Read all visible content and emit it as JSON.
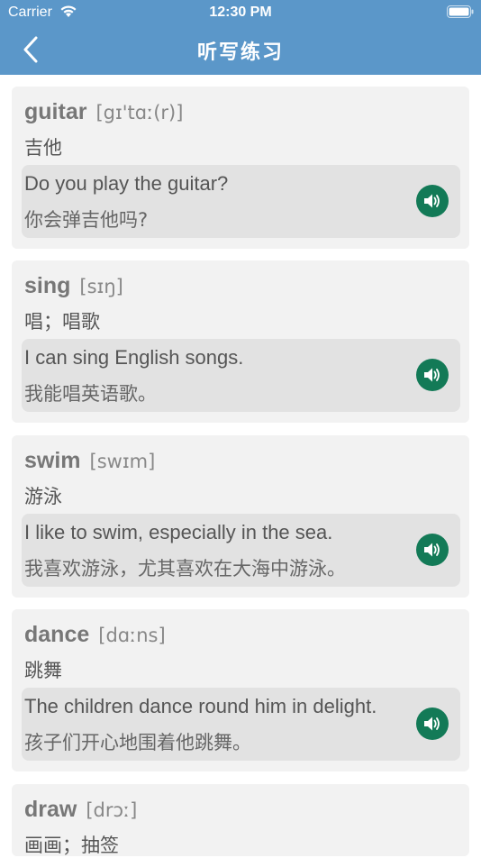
{
  "status_bar": {
    "carrier": "Carrier",
    "time": "12:30 PM"
  },
  "nav": {
    "title": "听写练习",
    "back_icon": "chevron-left-icon"
  },
  "colors": {
    "header": "#5b97c9",
    "speaker": "#137a57",
    "card": "#f2f2f2",
    "example": "#e2e2e2"
  },
  "words": [
    {
      "word": "guitar",
      "phonetic": "[gɪ'tɑː(r)]",
      "meaning": "吉他",
      "example_en": "Do you play the guitar?",
      "example_cn": "你会弹吉他吗?"
    },
    {
      "word": "sing",
      "phonetic": "[sɪŋ]",
      "meaning": "唱；唱歌",
      "example_en": "I can sing English songs.",
      "example_cn": "我能唱英语歌。"
    },
    {
      "word": "swim",
      "phonetic": "[swɪm]",
      "meaning": "游泳",
      "example_en": "I like to swim, especially in the sea.",
      "example_cn": "我喜欢游泳，尤其喜欢在大海中游泳。"
    },
    {
      "word": "dance",
      "phonetic": "[dɑːns]",
      "meaning": "跳舞",
      "example_en": "The children dance round him in delight.",
      "example_cn": "孩子们开心地围着他跳舞。"
    },
    {
      "word": "draw",
      "phonetic": "[drɔː]",
      "meaning": "画画；抽签",
      "example_en": "",
      "example_cn": ""
    }
  ]
}
